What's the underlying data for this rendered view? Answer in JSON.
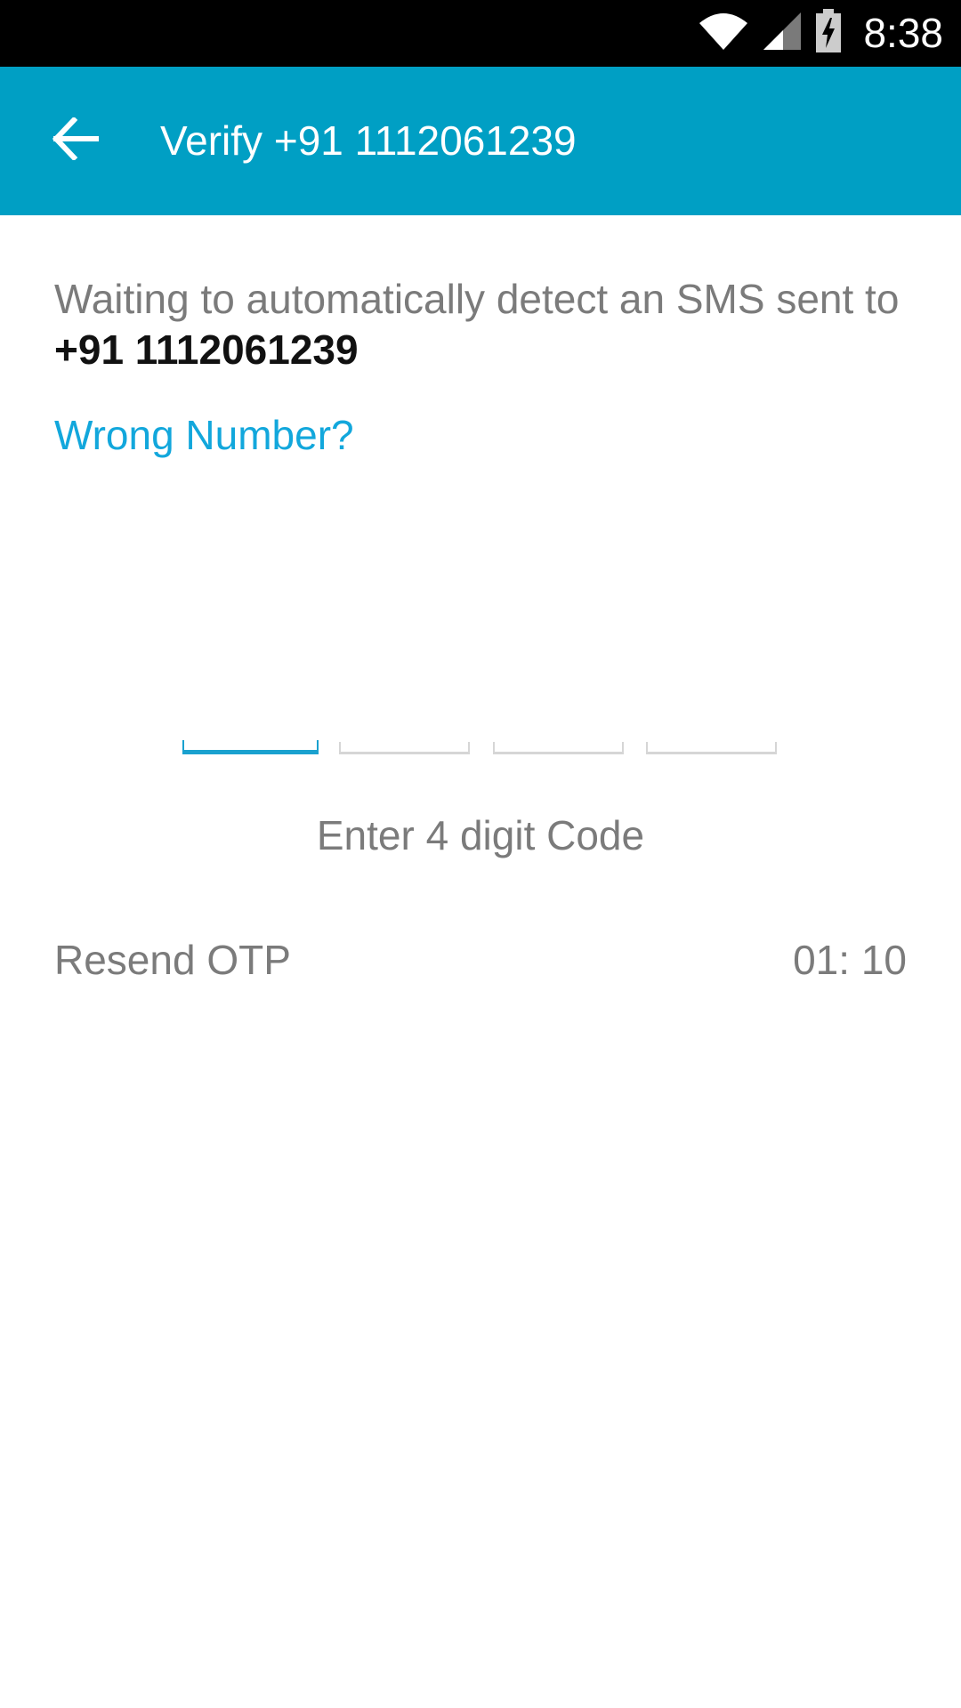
{
  "status_bar": {
    "time": "8:38",
    "icons": [
      "wifi-icon",
      "signal-icon",
      "battery-charging-icon"
    ]
  },
  "app_bar": {
    "back_icon": "arrow-left-icon",
    "title": "Verify +91 1112061239",
    "background": "#009fc4"
  },
  "content": {
    "waiting_prefix": "Waiting to automatically detect an SMS sent to ",
    "phone_number": "+91 1112061239",
    "wrong_number": "Wrong Number?",
    "otp_hint": "Enter 4 digit Code",
    "resend": "Resend OTP",
    "timer": "01: 10"
  },
  "otp": {
    "digits": [
      "",
      "",
      "",
      ""
    ],
    "active_index": 0
  },
  "colors": {
    "accent": "#12a7dc",
    "text_secondary": "#7b7b7b",
    "text_primary": "#111111"
  }
}
